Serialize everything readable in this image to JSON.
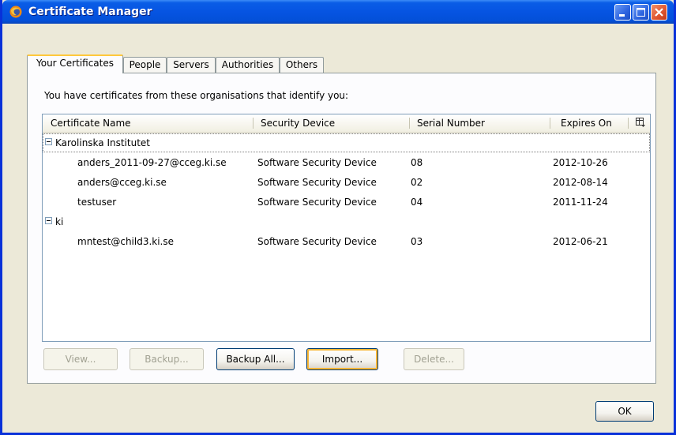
{
  "window": {
    "title": "Certificate Manager"
  },
  "tabs": [
    {
      "label": "Your Certificates",
      "active": true
    },
    {
      "label": "People",
      "active": false
    },
    {
      "label": "Servers",
      "active": false
    },
    {
      "label": "Authorities",
      "active": false
    },
    {
      "label": "Others",
      "active": false
    }
  ],
  "panel": {
    "description": "You have certificates from these organisations that identify you:"
  },
  "columns": {
    "name": "Certificate Name",
    "device": "Security Device",
    "serial": "Serial Number",
    "expires": "Expires On"
  },
  "groups": [
    {
      "name": "Karolinska Institutet",
      "rows": [
        {
          "name": "anders_2011-09-27@cceg.ki.se",
          "device": "Software Security Device",
          "serial": "08",
          "expires": "2012-10-26"
        },
        {
          "name": "anders@cceg.ki.se",
          "device": "Software Security Device",
          "serial": "02",
          "expires": "2012-08-14"
        },
        {
          "name": "testuser",
          "device": "Software Security Device",
          "serial": "04",
          "expires": "2011-11-24"
        }
      ]
    },
    {
      "name": "ki",
      "rows": [
        {
          "name": "mntest@child3.ki.se",
          "device": "Software Security Device",
          "serial": "03",
          "expires": "2012-06-21"
        }
      ]
    }
  ],
  "buttons": {
    "view": "View...",
    "backup": "Backup...",
    "backup_all": "Backup All...",
    "import": "Import...",
    "delete": "Delete...",
    "ok": "OK"
  },
  "colors": {
    "titlebar": "#0654e2",
    "dialog_bg": "#ece9d8",
    "active_tab_accent": "#ffc83c"
  }
}
